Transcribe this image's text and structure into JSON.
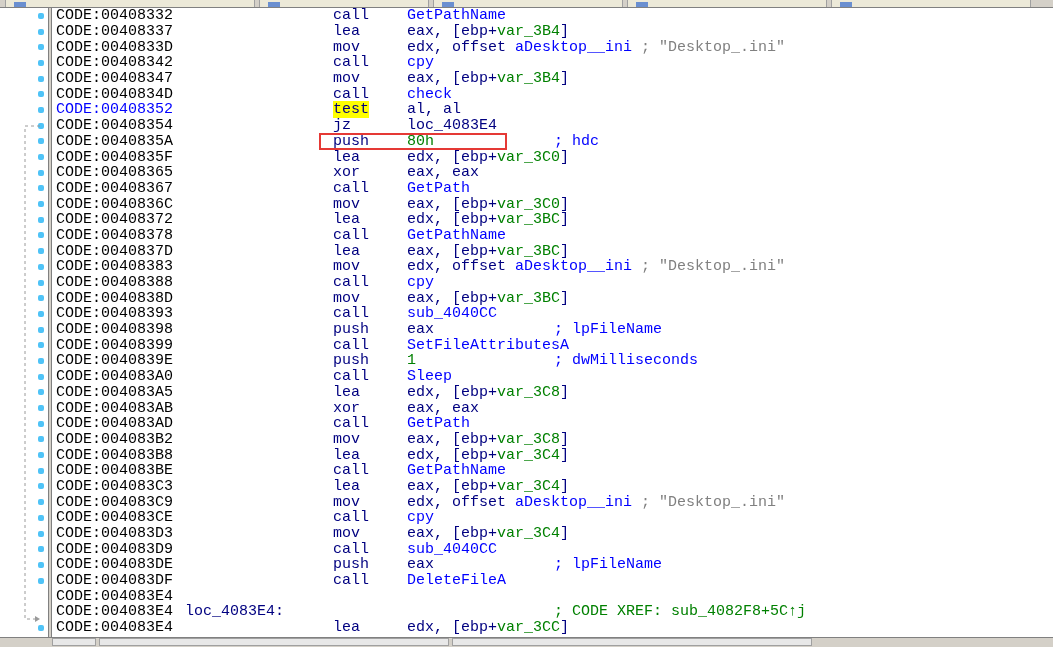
{
  "listing": [
    {
      "address": "CODE:00408332",
      "mnemonic": "call",
      "operands": [
        {
          "text": "GetPathName",
          "kind": "name"
        }
      ],
      "dot": true,
      "selected": false
    },
    {
      "address": "CODE:00408337",
      "mnemonic": "lea",
      "operands": [
        {
          "text": "eax, [ebp+",
          "kind": "plain"
        },
        {
          "text": "var_3B4",
          "kind": "value"
        },
        {
          "text": "]",
          "kind": "plain"
        }
      ],
      "dot": true,
      "selected": false
    },
    {
      "address": "CODE:0040833D",
      "mnemonic": "mov",
      "operands": [
        {
          "text": "edx, offset ",
          "kind": "plain"
        },
        {
          "text": "aDesktop__ini",
          "kind": "name"
        }
      ],
      "comment": {
        "text": "; \"Desktop_.ini\"",
        "kind": "string"
      },
      "dot": true,
      "selected": false
    },
    {
      "address": "CODE:00408342",
      "mnemonic": "call",
      "operands": [
        {
          "text": "cpy",
          "kind": "name"
        }
      ],
      "dot": true,
      "selected": false
    },
    {
      "address": "CODE:00408347",
      "mnemonic": "mov",
      "operands": [
        {
          "text": "eax, [ebp+",
          "kind": "plain"
        },
        {
          "text": "var_3B4",
          "kind": "value"
        },
        {
          "text": "]",
          "kind": "plain"
        }
      ],
      "dot": true,
      "selected": false
    },
    {
      "address": "CODE:0040834D",
      "mnemonic": "call",
      "operands": [
        {
          "text": "check",
          "kind": "name"
        }
      ],
      "dot": true,
      "selected": false
    },
    {
      "address": "CODE:00408352",
      "mnemonic": "test",
      "operands": [
        {
          "text": "al, al",
          "kind": "plain"
        }
      ],
      "dot": true,
      "selected": true,
      "cursor": true
    },
    {
      "address": "CODE:00408354",
      "mnemonic": "jz",
      "operands": [
        {
          "text": "loc_4083E4",
          "kind": "plain"
        }
      ],
      "dot": true,
      "selected": false
    },
    {
      "address": "CODE:0040835A",
      "mnemonic": "push",
      "operands": [
        {
          "text": "80h",
          "kind": "value"
        }
      ],
      "comment": {
        "text": "; hdc",
        "kind": "arg"
      },
      "dot": true,
      "selected": false,
      "boxed": true
    },
    {
      "address": "CODE:0040835F",
      "mnemonic": "lea",
      "operands": [
        {
          "text": "edx, [ebp+",
          "kind": "plain"
        },
        {
          "text": "var_3C0",
          "kind": "value"
        },
        {
          "text": "]",
          "kind": "plain"
        }
      ],
      "dot": true,
      "selected": false
    },
    {
      "address": "CODE:00408365",
      "mnemonic": "xor",
      "operands": [
        {
          "text": "eax, eax",
          "kind": "plain"
        }
      ],
      "dot": true,
      "selected": false
    },
    {
      "address": "CODE:00408367",
      "mnemonic": "call",
      "operands": [
        {
          "text": "GetPath",
          "kind": "name"
        }
      ],
      "dot": true,
      "selected": false
    },
    {
      "address": "CODE:0040836C",
      "mnemonic": "mov",
      "operands": [
        {
          "text": "eax, [ebp+",
          "kind": "plain"
        },
        {
          "text": "var_3C0",
          "kind": "value"
        },
        {
          "text": "]",
          "kind": "plain"
        }
      ],
      "dot": true,
      "selected": false
    },
    {
      "address": "CODE:00408372",
      "mnemonic": "lea",
      "operands": [
        {
          "text": "edx, [ebp+",
          "kind": "plain"
        },
        {
          "text": "var_3BC",
          "kind": "value"
        },
        {
          "text": "]",
          "kind": "plain"
        }
      ],
      "dot": true,
      "selected": false
    },
    {
      "address": "CODE:00408378",
      "mnemonic": "call",
      "operands": [
        {
          "text": "GetPathName",
          "kind": "name"
        }
      ],
      "dot": true,
      "selected": false
    },
    {
      "address": "CODE:0040837D",
      "mnemonic": "lea",
      "operands": [
        {
          "text": "eax, [ebp+",
          "kind": "plain"
        },
        {
          "text": "var_3BC",
          "kind": "value"
        },
        {
          "text": "]",
          "kind": "plain"
        }
      ],
      "dot": true,
      "selected": false
    },
    {
      "address": "CODE:00408383",
      "mnemonic": "mov",
      "operands": [
        {
          "text": "edx, offset ",
          "kind": "plain"
        },
        {
          "text": "aDesktop__ini",
          "kind": "name"
        }
      ],
      "comment": {
        "text": "; \"Desktop_.ini\"",
        "kind": "string"
      },
      "dot": true,
      "selected": false
    },
    {
      "address": "CODE:00408388",
      "mnemonic": "call",
      "operands": [
        {
          "text": "cpy",
          "kind": "name"
        }
      ],
      "dot": true,
      "selected": false
    },
    {
      "address": "CODE:0040838D",
      "mnemonic": "mov",
      "operands": [
        {
          "text": "eax, [ebp+",
          "kind": "plain"
        },
        {
          "text": "var_3BC",
          "kind": "value"
        },
        {
          "text": "]",
          "kind": "plain"
        }
      ],
      "dot": true,
      "selected": false
    },
    {
      "address": "CODE:00408393",
      "mnemonic": "call",
      "operands": [
        {
          "text": "sub_4040CC",
          "kind": "name"
        }
      ],
      "dot": true,
      "selected": false
    },
    {
      "address": "CODE:00408398",
      "mnemonic": "push",
      "operands": [
        {
          "text": "eax",
          "kind": "plain"
        }
      ],
      "comment": {
        "text": "; lpFileName",
        "kind": "arg"
      },
      "dot": true,
      "selected": false
    },
    {
      "address": "CODE:00408399",
      "mnemonic": "call",
      "operands": [
        {
          "text": "SetFileAttributesA",
          "kind": "name"
        }
      ],
      "dot": true,
      "selected": false
    },
    {
      "address": "CODE:0040839E",
      "mnemonic": "push",
      "operands": [
        {
          "text": "1",
          "kind": "value"
        }
      ],
      "comment": {
        "text": "; dwMilliseconds",
        "kind": "arg"
      },
      "dot": true,
      "selected": false
    },
    {
      "address": "CODE:004083A0",
      "mnemonic": "call",
      "operands": [
        {
          "text": "Sleep",
          "kind": "name"
        }
      ],
      "dot": true,
      "selected": false
    },
    {
      "address": "CODE:004083A5",
      "mnemonic": "lea",
      "operands": [
        {
          "text": "edx, [ebp+",
          "kind": "plain"
        },
        {
          "text": "var_3C8",
          "kind": "value"
        },
        {
          "text": "]",
          "kind": "plain"
        }
      ],
      "dot": true,
      "selected": false
    },
    {
      "address": "CODE:004083AB",
      "mnemonic": "xor",
      "operands": [
        {
          "text": "eax, eax",
          "kind": "plain"
        }
      ],
      "dot": true,
      "selected": false
    },
    {
      "address": "CODE:004083AD",
      "mnemonic": "call",
      "operands": [
        {
          "text": "GetPath",
          "kind": "name"
        }
      ],
      "dot": true,
      "selected": false
    },
    {
      "address": "CODE:004083B2",
      "mnemonic": "mov",
      "operands": [
        {
          "text": "eax, [ebp+",
          "kind": "plain"
        },
        {
          "text": "var_3C8",
          "kind": "value"
        },
        {
          "text": "]",
          "kind": "plain"
        }
      ],
      "dot": true,
      "selected": false
    },
    {
      "address": "CODE:004083B8",
      "mnemonic": "lea",
      "operands": [
        {
          "text": "edx, [ebp+",
          "kind": "plain"
        },
        {
          "text": "var_3C4",
          "kind": "value"
        },
        {
          "text": "]",
          "kind": "plain"
        }
      ],
      "dot": true,
      "selected": false
    },
    {
      "address": "CODE:004083BE",
      "mnemonic": "call",
      "operands": [
        {
          "text": "GetPathName",
          "kind": "name"
        }
      ],
      "dot": true,
      "selected": false
    },
    {
      "address": "CODE:004083C3",
      "mnemonic": "lea",
      "operands": [
        {
          "text": "eax, [ebp+",
          "kind": "plain"
        },
        {
          "text": "var_3C4",
          "kind": "value"
        },
        {
          "text": "]",
          "kind": "plain"
        }
      ],
      "dot": true,
      "selected": false
    },
    {
      "address": "CODE:004083C9",
      "mnemonic": "mov",
      "operands": [
        {
          "text": "edx, offset ",
          "kind": "plain"
        },
        {
          "text": "aDesktop__ini",
          "kind": "name"
        }
      ],
      "comment": {
        "text": "; \"Desktop_.ini\"",
        "kind": "string"
      },
      "dot": true,
      "selected": false
    },
    {
      "address": "CODE:004083CE",
      "mnemonic": "call",
      "operands": [
        {
          "text": "cpy",
          "kind": "name"
        }
      ],
      "dot": true,
      "selected": false
    },
    {
      "address": "CODE:004083D3",
      "mnemonic": "mov",
      "operands": [
        {
          "text": "eax, [ebp+",
          "kind": "plain"
        },
        {
          "text": "var_3C4",
          "kind": "value"
        },
        {
          "text": "]",
          "kind": "plain"
        }
      ],
      "dot": true,
      "selected": false
    },
    {
      "address": "CODE:004083D9",
      "mnemonic": "call",
      "operands": [
        {
          "text": "sub_4040CC",
          "kind": "name"
        }
      ],
      "dot": true,
      "selected": false
    },
    {
      "address": "CODE:004083DE",
      "mnemonic": "push",
      "operands": [
        {
          "text": "eax",
          "kind": "plain"
        }
      ],
      "comment": {
        "text": "; lpFileName",
        "kind": "arg"
      },
      "dot": true,
      "selected": false
    },
    {
      "address": "CODE:004083DF",
      "mnemonic": "call",
      "operands": [
        {
          "text": "DeleteFileA",
          "kind": "name"
        }
      ],
      "dot": true,
      "selected": false
    },
    {
      "address": "CODE:004083E4",
      "selected": false
    },
    {
      "address": "CODE:004083E4",
      "label": "loc_4083E4:",
      "comment": {
        "text": "; CODE XREF: sub_4082F8+5C↑j",
        "kind": "xref"
      },
      "selected": false
    },
    {
      "address": "CODE:004083E4",
      "mnemonic": "lea",
      "operands": [
        {
          "text": "edx, [ebp+",
          "kind": "plain"
        },
        {
          "text": "var_3CC",
          "kind": "value"
        },
        {
          "text": "]",
          "kind": "plain"
        }
      ],
      "dot": true,
      "selected": false
    }
  ]
}
